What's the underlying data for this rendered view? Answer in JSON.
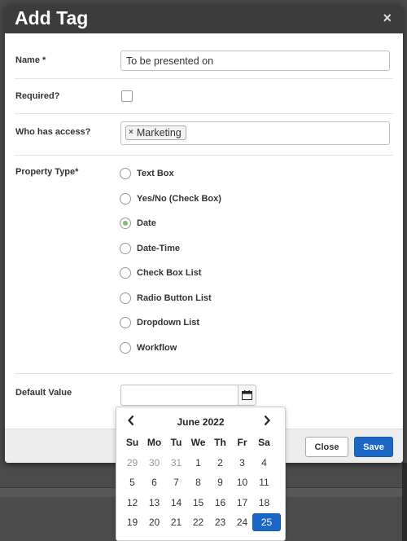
{
  "modal": {
    "title": "Add Tag",
    "close_glyph": "×"
  },
  "form": {
    "name": {
      "label": "Name *",
      "value": "To be presented on"
    },
    "required": {
      "label": "Required?",
      "checked": false
    },
    "access": {
      "label": "Who has access?",
      "tags": [
        {
          "label": "Marketing",
          "remove_glyph": "×"
        }
      ]
    },
    "property_type": {
      "label": "Property Type*",
      "options": [
        {
          "label": "Text Box",
          "checked": false
        },
        {
          "label": "Yes/No (Check Box)",
          "checked": false
        },
        {
          "label": "Date",
          "checked": true
        },
        {
          "label": "Date-Time",
          "checked": false
        },
        {
          "label": "Check Box List",
          "checked": false
        },
        {
          "label": "Radio Button List",
          "checked": false
        },
        {
          "label": "Dropdown List",
          "checked": false
        },
        {
          "label": "Workflow",
          "checked": false
        }
      ]
    },
    "default_value": {
      "label": "Default Value",
      "value": "",
      "icon": "calendar-icon"
    }
  },
  "footer": {
    "close_label": "Close",
    "save_label": "Save"
  },
  "datepicker": {
    "month_label": "June 2022",
    "prev_glyph": "‹",
    "next_glyph": "›",
    "weekdays": [
      "Su",
      "Mo",
      "Tu",
      "We",
      "Th",
      "Fr",
      "Sa"
    ],
    "weeks": [
      [
        "29",
        "30",
        "31",
        "1",
        "2",
        "3",
        "4"
      ],
      [
        "5",
        "6",
        "7",
        "8",
        "9",
        "10",
        "11"
      ],
      [
        "12",
        "13",
        "14",
        "15",
        "16",
        "17",
        "18"
      ],
      [
        "19",
        "20",
        "21",
        "22",
        "23",
        "24",
        "25"
      ]
    ],
    "muted_first_row_count": 3,
    "selected": "25"
  },
  "colors": {
    "accent": "#1c66c4",
    "header": "#3c3c3c",
    "radio_checked": "#7bc46a"
  }
}
